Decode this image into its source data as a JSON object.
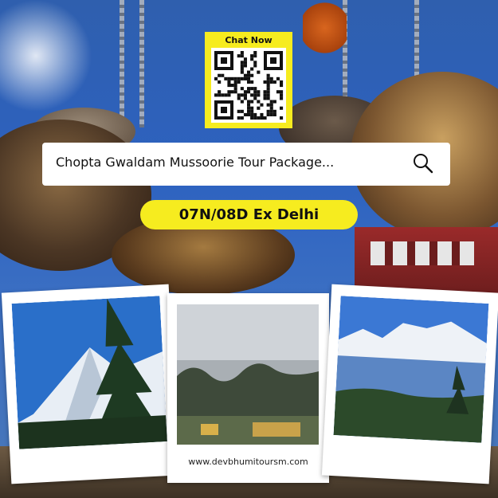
{
  "qr": {
    "title": "Chat Now"
  },
  "search": {
    "query": "Chopta Gwaldam Mussoorie Tour Package..."
  },
  "duration": {
    "label": "07N/08D Ex Delhi"
  },
  "footer": {
    "website": "www.devbhumitoursm.com"
  },
  "colors": {
    "accent_yellow": "#f6ec1f",
    "search_bg": "#ffffff",
    "sky_blue": "#2d62c0"
  }
}
